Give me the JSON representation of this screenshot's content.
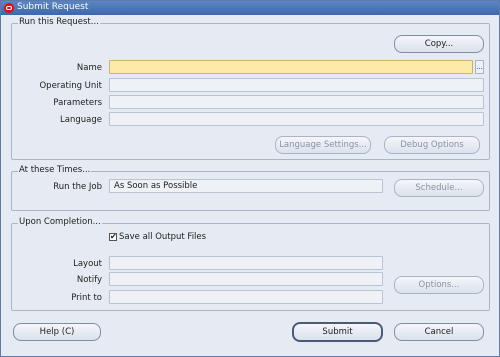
{
  "window": {
    "title": "Submit Request"
  },
  "run_request": {
    "group_label": "Run this Request...",
    "copy_button": "Copy...",
    "name_label": "Name",
    "name_value": "",
    "lov_label": "...",
    "operating_unit_label": "Operating Unit",
    "operating_unit_value": "",
    "parameters_label": "Parameters",
    "parameters_value": "",
    "language_label": "Language",
    "language_value": "",
    "language_settings_button": "Language Settings...",
    "debug_options_button": "Debug Options"
  },
  "times": {
    "group_label": "At these Times...",
    "run_job_label": "Run the Job",
    "run_job_value": "As Soon as Possible",
    "schedule_button": "Schedule..."
  },
  "completion": {
    "group_label": "Upon Completion...",
    "save_output_label": "Save all Output Files",
    "save_output_checked": true,
    "layout_label": "Layout",
    "layout_value": "",
    "notify_label": "Notify",
    "notify_value": "",
    "print_to_label": "Print to",
    "print_to_value": "",
    "options_button": "Options..."
  },
  "footer": {
    "help_button": "Help (C)",
    "submit_button": "Submit",
    "cancel_button": "Cancel"
  },
  "colors": {
    "required_field": "#fde9a8",
    "titlebar": "#4a76bb",
    "window_bg": "#e6ebf3"
  }
}
